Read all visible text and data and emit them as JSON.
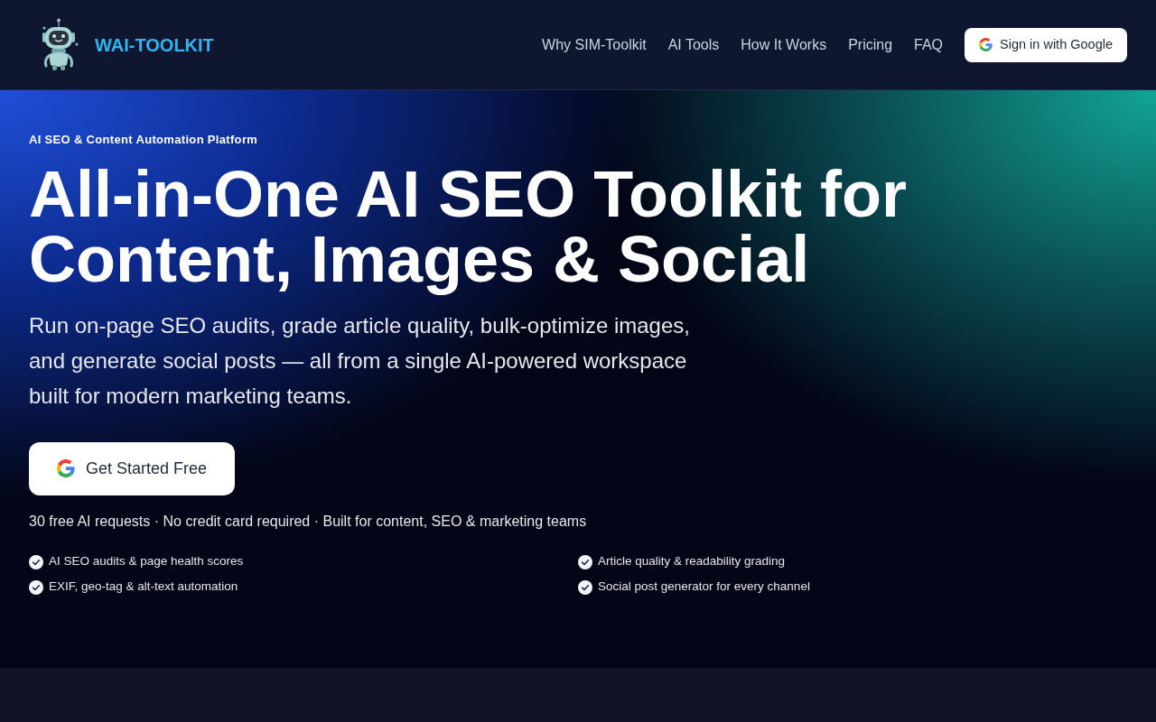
{
  "header": {
    "brand": "WAI-TOOLKIT",
    "nav": [
      {
        "label": "Why SIM-Toolkit"
      },
      {
        "label": "AI Tools"
      },
      {
        "label": "How It Works"
      },
      {
        "label": "Pricing"
      },
      {
        "label": "FAQ"
      }
    ],
    "sign_in": "Sign in with Google"
  },
  "hero": {
    "eyebrow": "AI SEO & Content Automation Platform",
    "title": "All-in-One AI SEO Toolkit for Content, Images & Social",
    "description": "Run on-page SEO audits, grade article quality, bulk-optimize images, and generate social posts — all from a single AI-powered workspace built for modern marketing teams.",
    "cta": "Get Started Free",
    "note": "30 free AI requests · No credit card required · Built for content, SEO & marketing teams",
    "features": [
      "AI SEO audits & page health scores",
      "Article quality & readability grading",
      "EXIF, geo-tag & alt-text automation",
      "Social post generator for every channel"
    ]
  }
}
